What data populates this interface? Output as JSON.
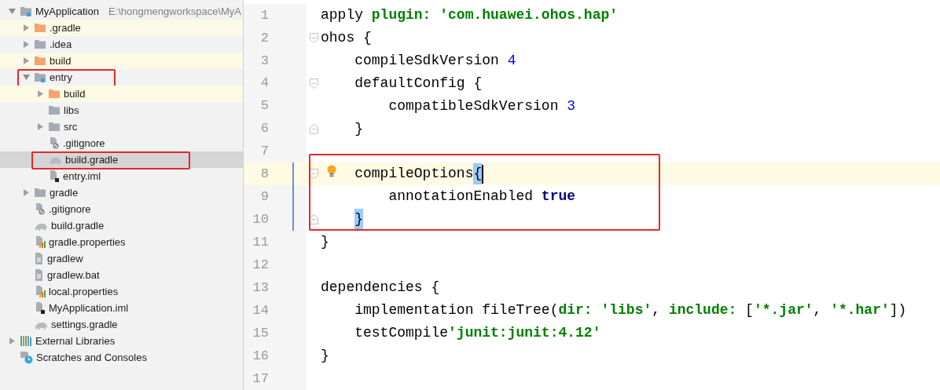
{
  "project_tree": {
    "items": [
      {
        "label": "MyApplication",
        "path": "E:\\hongmengworkspace\\MyA",
        "kind": "module",
        "expanded": true,
        "selected": false,
        "ignored": false,
        "boxed": false,
        "children": [
          {
            "label": ".gradle",
            "kind": "folder-excluded",
            "expanded": false,
            "selected": false,
            "ignored": true,
            "boxed": false
          },
          {
            "label": ".idea",
            "kind": "folder",
            "expanded": false,
            "selected": false,
            "ignored": false,
            "boxed": false
          },
          {
            "label": "build",
            "kind": "folder-excluded",
            "expanded": false,
            "selected": false,
            "ignored": true,
            "boxed": false
          },
          {
            "label": "entry",
            "kind": "module",
            "expanded": true,
            "selected": false,
            "ignored": false,
            "boxed": true,
            "children": [
              {
                "label": "build",
                "kind": "folder-excluded",
                "expanded": false,
                "selected": false,
                "ignored": true,
                "boxed": false
              },
              {
                "label": "libs",
                "kind": "folder",
                "selected": false,
                "ignored": false,
                "boxed": false
              },
              {
                "label": "src",
                "kind": "folder",
                "expanded": false,
                "selected": false,
                "ignored": false,
                "boxed": false
              },
              {
                "label": ".gitignore",
                "kind": "ignore-file",
                "selected": false,
                "ignored": false,
                "boxed": false
              },
              {
                "label": "build.gradle",
                "kind": "gradle",
                "selected": true,
                "ignored": false,
                "boxed": true
              },
              {
                "label": "entry.iml",
                "kind": "iml",
                "selected": false,
                "ignored": false,
                "boxed": false
              }
            ]
          },
          {
            "label": "gradle",
            "kind": "folder",
            "expanded": false,
            "selected": false,
            "ignored": false,
            "boxed": false
          },
          {
            "label": ".gitignore",
            "kind": "ignore-file",
            "selected": false,
            "ignored": false,
            "boxed": false
          },
          {
            "label": "build.gradle",
            "kind": "gradle",
            "selected": false,
            "ignored": false,
            "boxed": false
          },
          {
            "label": "gradle.properties",
            "kind": "properties",
            "selected": false,
            "ignored": false,
            "boxed": false
          },
          {
            "label": "gradlew",
            "kind": "text-file",
            "selected": false,
            "ignored": false,
            "boxed": false
          },
          {
            "label": "gradlew.bat",
            "kind": "text-file",
            "selected": false,
            "ignored": false,
            "boxed": false
          },
          {
            "label": "local.properties",
            "kind": "properties",
            "selected": false,
            "ignored": false,
            "boxed": false
          },
          {
            "label": "MyApplication.iml",
            "kind": "iml",
            "selected": false,
            "ignored": false,
            "boxed": false
          },
          {
            "label": "settings.gradle",
            "kind": "gradle",
            "selected": false,
            "ignored": false,
            "boxed": false
          }
        ]
      },
      {
        "label": "External Libraries",
        "kind": "libraries",
        "expanded": false,
        "selected": false,
        "ignored": false,
        "boxed": false
      },
      {
        "label": "Scratches and Consoles",
        "kind": "scratches",
        "selected": false,
        "ignored": false,
        "boxed": false
      }
    ]
  },
  "editor": {
    "lines": [
      {
        "number": "1",
        "tokens": [
          {
            "kind": "plain",
            "text": "apply "
          },
          {
            "kind": "name",
            "text": "plugin: "
          },
          {
            "kind": "string",
            "text": "'com.huawei.ohos.hap'"
          }
        ],
        "fold_start": false,
        "fold_end": false,
        "current": false,
        "boxed": false,
        "changed": false,
        "hint": false,
        "caret": false
      },
      {
        "number": "2",
        "tokens": [
          {
            "kind": "plain",
            "text": "ohos {"
          }
        ],
        "fold_start": true,
        "fold_end": false,
        "current": false,
        "boxed": false,
        "changed": false,
        "hint": false,
        "caret": false
      },
      {
        "number": "3",
        "tokens": [
          {
            "kind": "plain",
            "text": "    compileSdkVersion "
          },
          {
            "kind": "number",
            "text": "4"
          }
        ],
        "fold_start": false,
        "fold_end": false,
        "current": false,
        "boxed": false,
        "changed": false,
        "hint": false,
        "caret": false
      },
      {
        "number": "4",
        "tokens": [
          {
            "kind": "plain",
            "text": "    defaultConfig {"
          }
        ],
        "fold_start": true,
        "fold_end": false,
        "current": false,
        "boxed": false,
        "changed": false,
        "hint": false,
        "caret": false
      },
      {
        "number": "5",
        "tokens": [
          {
            "kind": "plain",
            "text": "        compatibleSdkVersion "
          },
          {
            "kind": "number",
            "text": "3"
          }
        ],
        "fold_start": false,
        "fold_end": false,
        "current": false,
        "boxed": false,
        "changed": false,
        "hint": false,
        "caret": false
      },
      {
        "number": "6",
        "tokens": [
          {
            "kind": "plain",
            "text": "    }"
          }
        ],
        "fold_start": false,
        "fold_end": true,
        "current": false,
        "boxed": false,
        "changed": false,
        "hint": false,
        "caret": false
      },
      {
        "number": "7",
        "fold_start": false,
        "fold_end": false,
        "current": false,
        "boxed": false,
        "changed": false,
        "hint": false,
        "caret": false
      },
      {
        "number": "8",
        "tokens": [
          {
            "kind": "plain",
            "text": "    compileOptions"
          },
          {
            "kind": "brace",
            "text": "{"
          }
        ],
        "fold_start": true,
        "fold_end": false,
        "current": true,
        "boxed": true,
        "changed": true,
        "hint": true,
        "caret": true
      },
      {
        "number": "9",
        "tokens": [
          {
            "kind": "plain",
            "text": "        annotationEnabled "
          },
          {
            "kind": "keyword",
            "text": "true"
          }
        ],
        "fold_start": false,
        "fold_end": false,
        "current": false,
        "boxed": true,
        "changed": true,
        "hint": false,
        "caret": false
      },
      {
        "number": "10",
        "tokens": [
          {
            "kind": "brace",
            "text": "    }"
          }
        ],
        "fold_start": false,
        "fold_end": true,
        "current": false,
        "boxed": true,
        "changed": true,
        "hint": false,
        "caret": false
      },
      {
        "number": "11",
        "tokens": [
          {
            "kind": "plain",
            "text": "}"
          }
        ],
        "fold_start": false,
        "fold_end": false,
        "current": false,
        "boxed": false,
        "changed": false,
        "hint": false,
        "caret": false
      },
      {
        "number": "12",
        "fold_start": false,
        "fold_end": false,
        "current": false,
        "boxed": false,
        "changed": false,
        "hint": false,
        "caret": false
      },
      {
        "number": "13",
        "tokens": [
          {
            "kind": "plain",
            "text": "dependencies {"
          }
        ],
        "fold_start": false,
        "fold_end": false,
        "current": false,
        "boxed": false,
        "changed": false,
        "hint": false,
        "caret": false
      },
      {
        "number": "14",
        "tokens": [
          {
            "kind": "plain",
            "text": "    implementation fileTree("
          },
          {
            "kind": "name",
            "text": "dir: "
          },
          {
            "kind": "string",
            "text": "'libs'"
          },
          {
            "kind": "plain",
            "text": ", "
          },
          {
            "kind": "name",
            "text": "include: "
          },
          {
            "kind": "plain",
            "text": "["
          },
          {
            "kind": "string",
            "text": "'*.jar'"
          },
          {
            "kind": "plain",
            "text": ", "
          },
          {
            "kind": "string",
            "text": "'*.har'"
          },
          {
            "kind": "plain",
            "text": "])"
          }
        ],
        "fold_start": false,
        "fold_end": false,
        "current": false,
        "boxed": false,
        "changed": false,
        "hint": false,
        "caret": false
      },
      {
        "number": "15",
        "tokens": [
          {
            "kind": "plain",
            "text": "    testCompile"
          },
          {
            "kind": "string",
            "text": "'junit:junit:4.12'"
          }
        ],
        "fold_start": false,
        "fold_end": false,
        "current": false,
        "boxed": false,
        "changed": false,
        "hint": false,
        "caret": false
      },
      {
        "number": "16",
        "tokens": [
          {
            "kind": "plain",
            "text": "}"
          }
        ],
        "fold_start": false,
        "fold_end": false,
        "current": false,
        "boxed": false,
        "changed": false,
        "hint": false,
        "caret": false
      },
      {
        "number": "17",
        "fold_start": false,
        "fold_end": false,
        "current": false,
        "boxed": false,
        "changed": false,
        "hint": false,
        "caret": false
      }
    ]
  }
}
